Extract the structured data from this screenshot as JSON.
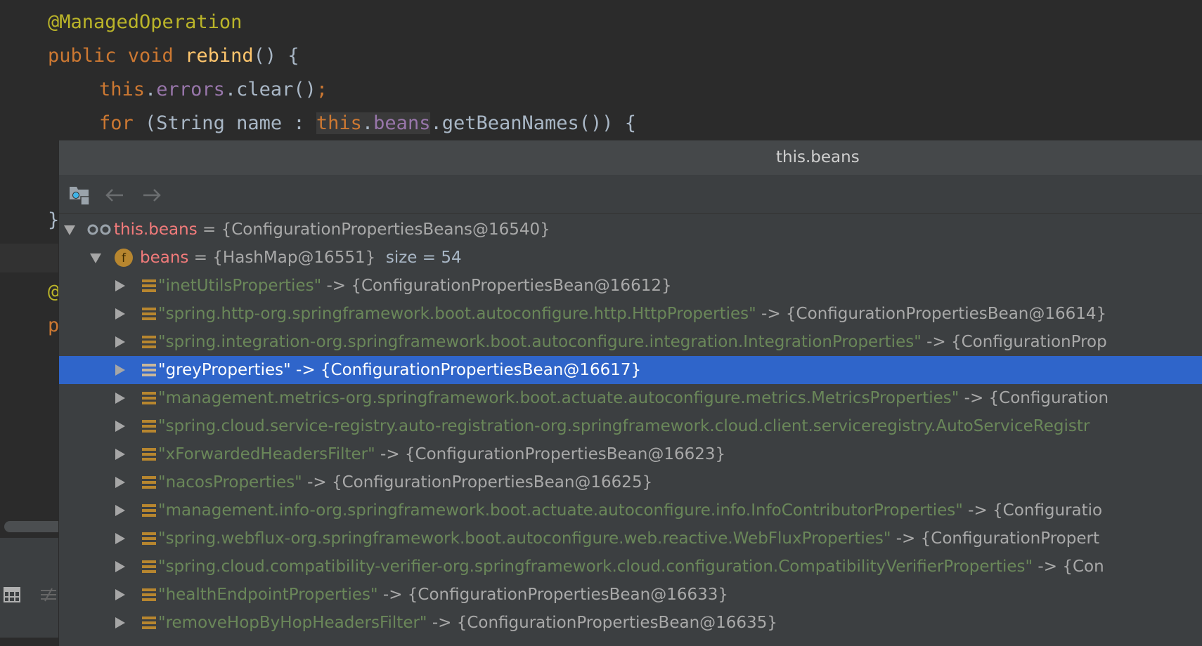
{
  "editor": {
    "lines": [
      {
        "parts": [
          [
            "ann",
            "@ManagedOperation"
          ]
        ]
      },
      {
        "parts": [
          [
            "kw",
            "public void "
          ],
          [
            "fn",
            "rebind"
          ],
          [
            "",
            "() {"
          ]
        ]
      },
      {
        "parts": [
          [
            "kw",
            "this"
          ],
          [
            "",
            "."
          ],
          [
            "fld",
            "errors"
          ],
          [
            "",
            ".clear()"
          ],
          [
            "kw",
            ";"
          ]
        ]
      },
      {
        "parts": [
          [
            "kw",
            "for "
          ],
          [
            "",
            "(String name : "
          ],
          [
            "kw hl",
            "this"
          ],
          [
            "hl",
            "."
          ],
          [
            "fld hl",
            "beans"
          ],
          [
            "",
            ".getBeanNames()) {"
          ]
        ]
      }
    ],
    "brace": "}",
    "partial_at": "@",
    "partial_p": "p"
  },
  "popup": {
    "title": "this.beans",
    "toolbar": {
      "icons": [
        "inspect-object-icon",
        "back-arrow-icon",
        "forward-arrow-icon"
      ]
    },
    "root": {
      "name": "this.beans",
      "value": "= {ConfigurationPropertiesBeans@16540}"
    },
    "field": {
      "name": "beans",
      "value": "= {HashMap@16551}",
      "size": "size = 54"
    },
    "entries": [
      {
        "key": "\"inetUtilsProperties\"",
        "value": " -> {ConfigurationPropertiesBean@16612}"
      },
      {
        "key": "\"spring.http-org.springframework.boot.autoconfigure.http.HttpProperties\"",
        "value": " -> {ConfigurationPropertiesBean@16614}"
      },
      {
        "key": "\"spring.integration-org.springframework.boot.autoconfigure.integration.IntegrationProperties\"",
        "value": " -> {ConfigurationProp"
      },
      {
        "key": "\"greyProperties\"",
        "value": " -> {ConfigurationPropertiesBean@16617}",
        "selected": true
      },
      {
        "key": "\"management.metrics-org.springframework.boot.actuate.autoconfigure.metrics.MetricsProperties\"",
        "value": " -> {Configuration"
      },
      {
        "key": "\"spring.cloud.service-registry.auto-registration-org.springframework.cloud.client.serviceregistry.AutoServiceRegistr",
        "value": ""
      },
      {
        "key": "\"xForwardedHeadersFilter\"",
        "value": " -> {ConfigurationPropertiesBean@16623}"
      },
      {
        "key": "\"nacosProperties\"",
        "value": " -> {ConfigurationPropertiesBean@16625}"
      },
      {
        "key": "\"management.info-org.springframework.boot.actuate.autoconfigure.info.InfoContributorProperties\"",
        "value": " -> {Configuratio"
      },
      {
        "key": "\"spring.webflux-org.springframework.boot.autoconfigure.web.reactive.WebFluxProperties\"",
        "value": " -> {ConfigurationPropert"
      },
      {
        "key": "\"spring.cloud.compatibility-verifier-org.springframework.cloud.configuration.CompatibilityVerifierProperties\"",
        "value": " -> {Con"
      },
      {
        "key": "\"healthEndpointProperties\"",
        "value": " -> {ConfigurationPropertiesBean@16633}"
      },
      {
        "key": "\"removeHopByHopHeadersFilter\"",
        "value": " -> {ConfigurationPropertiesBean@16635}"
      }
    ]
  },
  "colors": {
    "selection": "#2f65ca",
    "key": "#6a8759",
    "name": "#f27b7b",
    "field_icon": "#b7862f"
  }
}
